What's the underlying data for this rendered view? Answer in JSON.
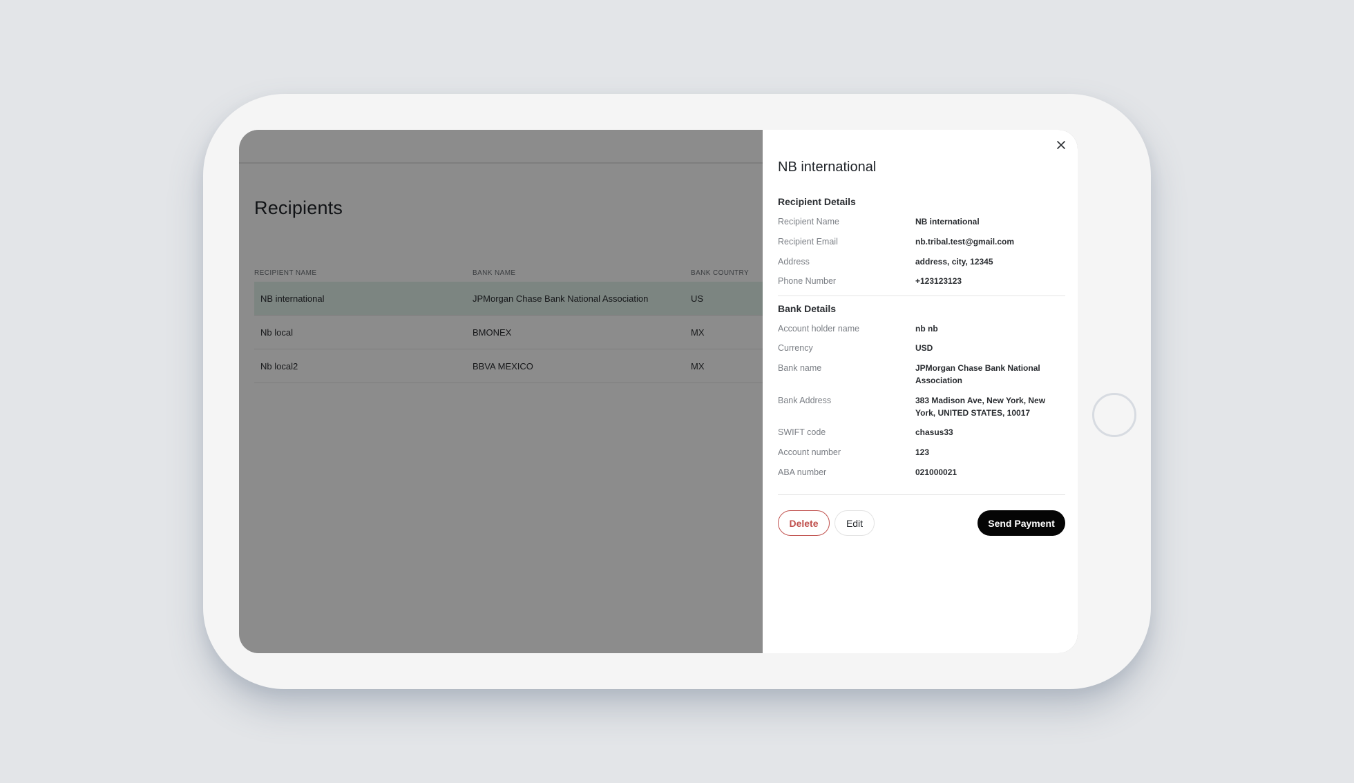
{
  "page": {
    "title": "Recipients"
  },
  "table": {
    "headers": [
      "RECIPIENT NAME",
      "BANK NAME",
      "BANK COUNTRY"
    ],
    "rows": [
      {
        "recipient": "NB international",
        "bank": "JPMorgan Chase Bank National Association",
        "country": "US",
        "selected": true
      },
      {
        "recipient": "Nb local",
        "bank": "BMONEX",
        "country": "MX",
        "selected": false
      },
      {
        "recipient": "Nb local2",
        "bank": "BBVA MEXICO",
        "country": "MX",
        "selected": false
      }
    ]
  },
  "drawer": {
    "title": "NB international",
    "close_icon": "close-icon",
    "recipient_section": {
      "title": "Recipient Details",
      "fields": [
        {
          "label": "Recipient Name",
          "value": "NB international"
        },
        {
          "label": "Recipient Email",
          "value": "nb.tribal.test@gmail.com"
        },
        {
          "label": "Address",
          "value": "address, city, 12345"
        },
        {
          "label": "Phone Number",
          "value": "+123123123"
        }
      ]
    },
    "bank_section": {
      "title": "Bank Details",
      "fields": [
        {
          "label": "Account holder name",
          "value": "nb nb"
        },
        {
          "label": "Currency",
          "value": "USD"
        },
        {
          "label": "Bank name",
          "value": "JPMorgan Chase Bank National Association"
        },
        {
          "label": "Bank Address",
          "value": "383 Madison Ave, New York, New York, UNITED STATES, 10017"
        },
        {
          "label": "SWIFT code",
          "value": "chasus33"
        },
        {
          "label": "Account number",
          "value": "123"
        },
        {
          "label": "ABA number",
          "value": "021000021"
        }
      ]
    },
    "actions": {
      "delete": "Delete",
      "edit": "Edit",
      "send": "Send Payment"
    }
  },
  "colors": {
    "selected_row": "#e2f2ec",
    "delete": "#c0504d",
    "primary": "#050505",
    "overlay": "rgba(0,0,0,0.45)"
  }
}
